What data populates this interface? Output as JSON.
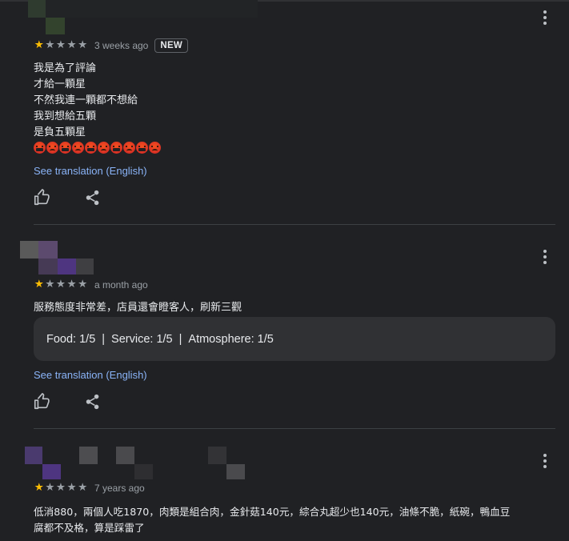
{
  "colors": {
    "background": "#202124",
    "star_on": "#fbbc04",
    "star_off": "#9aa0a6",
    "link": "#8ab4f8",
    "attr_box": "#303134"
  },
  "icons": {
    "menu": "more-vert-icon",
    "like": "thumb-up-icon",
    "share": "share-icon",
    "star": "star-icon"
  },
  "reviews": [
    {
      "rating": 1,
      "max_rating": 5,
      "date": "3 weeks ago",
      "badge": "NEW",
      "lines": [
        "我是為了評論",
        "才給一顆星",
        "不然我連一顆都不想給",
        "我到想給五顆",
        "是負五顆星"
      ],
      "emojis": [
        "cursing-face",
        "angry-face",
        "cursing-face",
        "angry-face",
        "cursing-face",
        "angry-face",
        "cursing-face",
        "angry-face",
        "cursing-face",
        "angry-face"
      ],
      "translate_label": "See translation (English)"
    },
    {
      "rating": 1,
      "max_rating": 5,
      "date": "a month ago",
      "lines": [
        "服務態度非常差，店員還會瞪客人，刷新三觀"
      ],
      "attributes": [
        {
          "label": "Food: 1/5"
        },
        {
          "label": "Service: 1/5"
        },
        {
          "label": "Atmosphere: 1/5"
        }
      ],
      "attr_separator": "|",
      "translate_label": "See translation (English)"
    },
    {
      "rating": 1,
      "max_rating": 5,
      "date": "7 years ago",
      "lines": [
        "低消880，兩個人吃1870，肉類是組合肉，金針菇140元，綜合丸超少也140元，油條不脆，紙碗，鴨血豆",
        "腐都不及格，算是踩雷了"
      ]
    }
  ]
}
